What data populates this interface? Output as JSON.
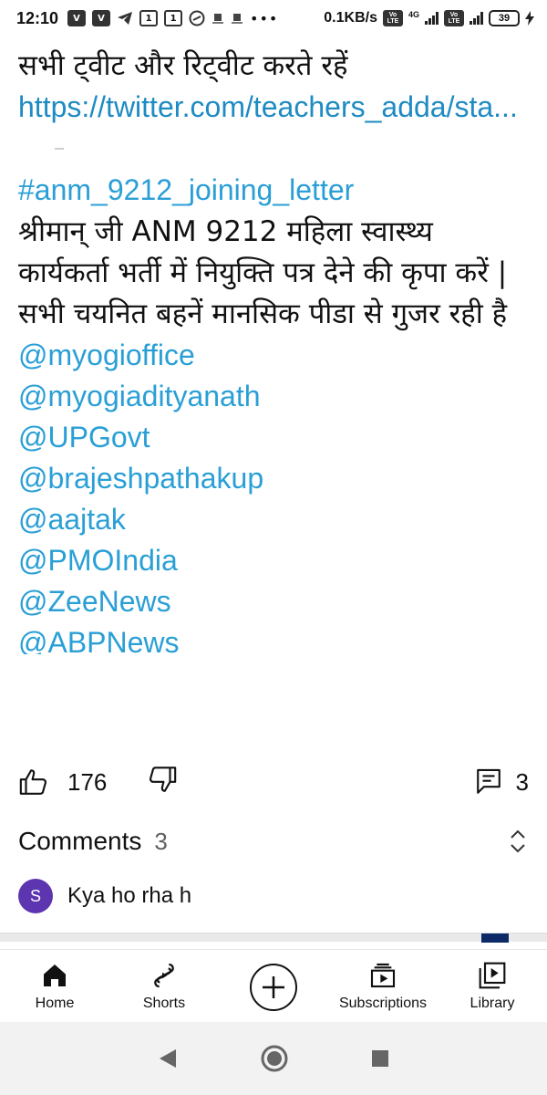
{
  "status_bar": {
    "time": "12:10",
    "data_rate": "0.1KB/s",
    "battery_level": "39",
    "net_label": "4G",
    "volte_label": "Vo LTE"
  },
  "post": {
    "line1": "सभी ट्वीट और रिट्वीट करते रहें",
    "link": "https://twitter.com/teachers_adda/sta...",
    "hashtag": "#anm_9212_joining_letter",
    "body": "श्रीमान् जी ANM 9212 महिला स्वास्थ्य कार्यकर्ता भर्ती में नियुक्ति पत्र देने की कृपा करें | सभी चयनित बहनें मानसिक पीडा से गुजर रही है",
    "mentions": [
      "@myogioffice",
      "@myogiadityanath",
      "@UPGovt",
      "@brajeshpathakup",
      "@aajtak",
      "@PMOIndia",
      "@ZeeNews",
      "@ABPNews"
    ]
  },
  "actions": {
    "like_count": "176",
    "comment_count": "3",
    "like_icon": "thumbs-up-icon",
    "dislike_icon": "thumbs-down-icon",
    "comment_icon": "comment-icon"
  },
  "comments": {
    "title": "Comments",
    "count": "3",
    "first": {
      "avatar_letter": "S",
      "text": "Kya ho rha h"
    }
  },
  "bottom_nav": {
    "items": [
      {
        "label": "Home",
        "icon": "home-icon"
      },
      {
        "label": "Shorts",
        "icon": "shorts-icon"
      },
      {
        "label": "",
        "icon": "create-icon"
      },
      {
        "label": "Subscriptions",
        "icon": "subscriptions-icon"
      },
      {
        "label": "Library",
        "icon": "library-icon"
      }
    ]
  },
  "colors": {
    "link": "#1e8bc3",
    "mention": "#2a9fd6",
    "avatar": "#5e35b1",
    "battery": "#5cc66a"
  }
}
